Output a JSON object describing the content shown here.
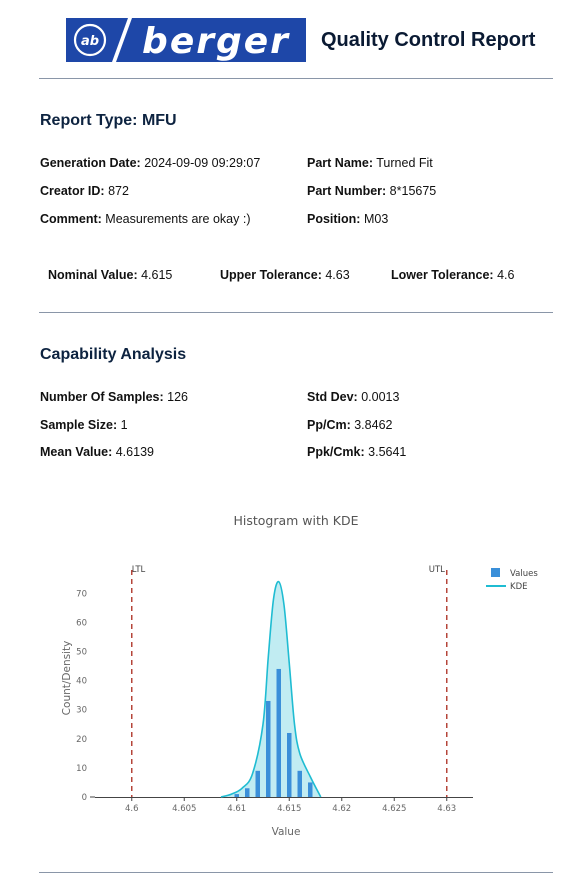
{
  "header": {
    "logo_text": "berger",
    "logo_emblem_text": "ab",
    "title": "Quality Control Report",
    "brand_color": "#1e47a8"
  },
  "report": {
    "type_label": "Report Type:",
    "type_value": "MFU",
    "generation_date": {
      "label": "Generation Date:",
      "value": "2024-09-09 09:29:07"
    },
    "creator_id": {
      "label": "Creator ID:",
      "value": "872"
    },
    "comment": {
      "label": "Comment:",
      "value": "Measurements are okay :)"
    },
    "part_name": {
      "label": "Part Name:",
      "value": "Turned Fit"
    },
    "part_number": {
      "label": "Part Number:",
      "value": "8*15675"
    },
    "position": {
      "label": "Position:",
      "value": "M03"
    },
    "nominal_value": {
      "label": "Nominal Value:",
      "value": "4.615"
    },
    "upper_tolerance": {
      "label": "Upper Tolerance:",
      "value": "4.63"
    },
    "lower_tolerance": {
      "label": "Lower Tolerance:",
      "value": "4.6"
    }
  },
  "capability": {
    "title": "Capability Analysis",
    "number_of_samples": {
      "label": "Number Of Samples:",
      "value": "126"
    },
    "sample_size": {
      "label": "Sample Size:",
      "value": "1"
    },
    "mean_value": {
      "label": "Mean Value:",
      "value": "4.6139"
    },
    "std_dev": {
      "label": "Std Dev:",
      "value": "0.0013"
    },
    "pp_cm": {
      "label": "Pp/Cm:",
      "value": "3.8462"
    },
    "ppk_cmk": {
      "label": "Ppk/Cmk:",
      "value": "3.5641"
    }
  },
  "chart_data": {
    "type": "bar",
    "title": "Histogram with KDE",
    "xlabel": "Value",
    "ylabel": "Count/Density",
    "xlim": [
      4.5965,
      4.6325
    ],
    "ylim": [
      0,
      78
    ],
    "xticks": [
      4.6,
      4.605,
      4.61,
      4.615,
      4.62,
      4.625,
      4.63
    ],
    "xtick_labels": [
      "4.6",
      "4.605",
      "4.61",
      "4.615",
      "4.62",
      "4.625",
      "4.63"
    ],
    "yticks": [
      0,
      10,
      20,
      30,
      40,
      50,
      60,
      70
    ],
    "grid": false,
    "legend_position": "top-right",
    "bar_color": "#3a8fd9",
    "kde_color": "#1fbcd2",
    "limit_color": "#b5453a",
    "histogram": {
      "name": "Values",
      "x": [
        4.61,
        4.611,
        4.612,
        4.613,
        4.614,
        4.615,
        4.616,
        4.617
      ],
      "values": [
        1,
        3,
        9,
        33,
        44,
        22,
        9,
        5
      ]
    },
    "kde": {
      "name": "KDE",
      "x": [
        4.6085,
        4.6095,
        4.6105,
        4.6115,
        4.6125,
        4.613,
        4.6135,
        4.614,
        4.6145,
        4.615,
        4.6155,
        4.616,
        4.617,
        4.618
      ],
      "y": [
        0,
        1,
        3,
        8,
        25,
        48,
        68,
        74,
        66,
        46,
        25,
        15,
        7,
        0
      ]
    },
    "limits": [
      {
        "label": "LTL",
        "x": 4.6
      },
      {
        "label": "UTL",
        "x": 4.63
      }
    ]
  }
}
